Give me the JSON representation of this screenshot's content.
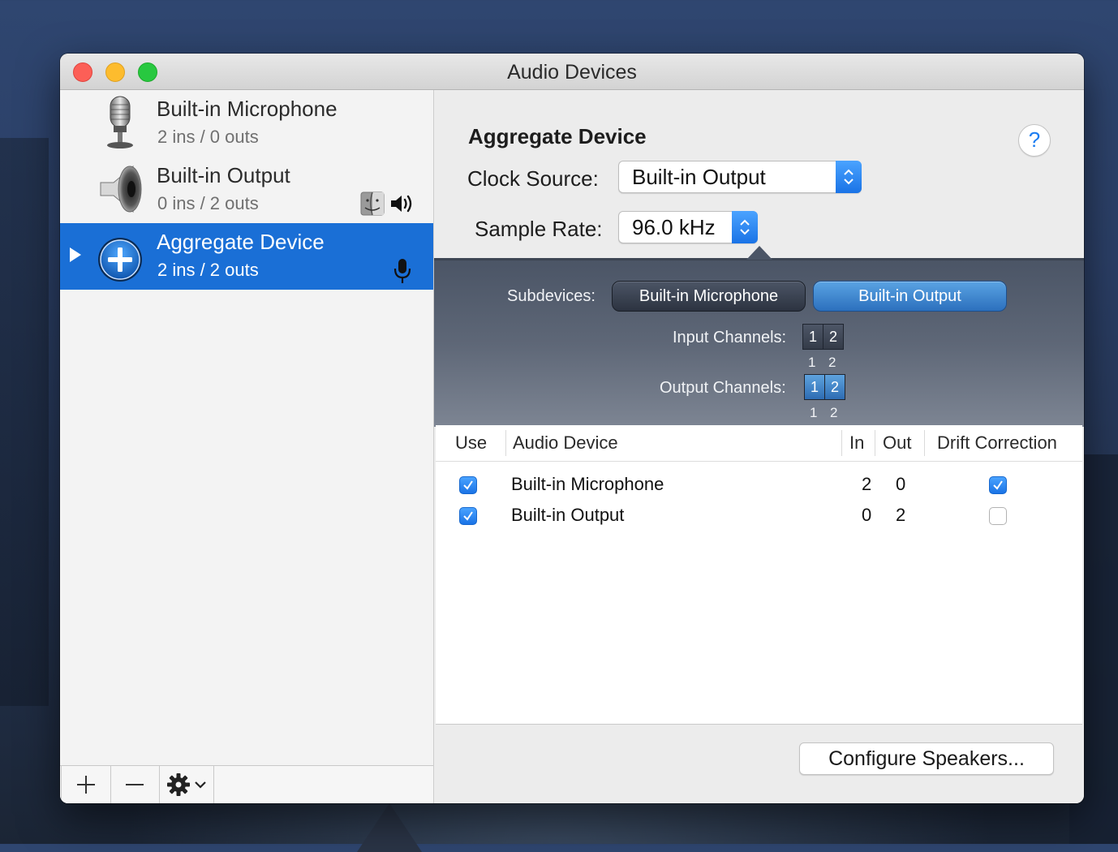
{
  "window": {
    "title": "Audio Devices"
  },
  "sidebar": {
    "devices": [
      {
        "name": "Built-in Microphone",
        "io": "2 ins / 0 outs",
        "icon": "microphone-icon"
      },
      {
        "name": "Built-in Output",
        "io": "0 ins / 2 outs",
        "icon": "speaker-icon",
        "badges": [
          "finder-icon",
          "speaker-volume-icon"
        ]
      },
      {
        "name": "Aggregate Device",
        "io": "2 ins / 2 outs",
        "icon": "aggregate-plus-icon",
        "selected": true,
        "badges": [
          "microphone-small-icon"
        ]
      }
    ],
    "toolbar": {
      "add": "+",
      "remove": "−",
      "gear": "gear-menu-icon"
    }
  },
  "detail": {
    "device_title": "Aggregate Device",
    "help_label": "?",
    "clock_source": {
      "label": "Clock Source:",
      "value": "Built-in Output"
    },
    "sample_rate": {
      "label": "Sample Rate:",
      "value": "96.0 kHz"
    },
    "subdevices": {
      "label": "Subdevices:",
      "items": [
        "Built-in Microphone",
        "Built-in Output"
      ],
      "input_channels_label": "Input Channels:",
      "input_channels": [
        "1",
        "2"
      ],
      "input_channel_numbers": [
        "1",
        "2"
      ],
      "output_channels_label": "Output Channels:",
      "output_channels": [
        "1",
        "2"
      ],
      "output_channel_numbers": [
        "1",
        "2"
      ]
    },
    "table": {
      "columns": [
        "Use",
        "Audio Device",
        "In",
        "Out",
        "Drift Correction"
      ],
      "rows": [
        {
          "use": true,
          "device": "Built-in Microphone",
          "in": "2",
          "out": "0",
          "drift": true
        },
        {
          "use": true,
          "device": "Built-in Output",
          "in": "0",
          "out": "2",
          "drift": false
        }
      ]
    },
    "configure_button": "Configure Speakers..."
  },
  "colors": {
    "selection": "#1a6fd6",
    "accent": "#1b7df2",
    "close": "#fc5f57",
    "minimize": "#fdbc2e",
    "zoom": "#28c840"
  }
}
